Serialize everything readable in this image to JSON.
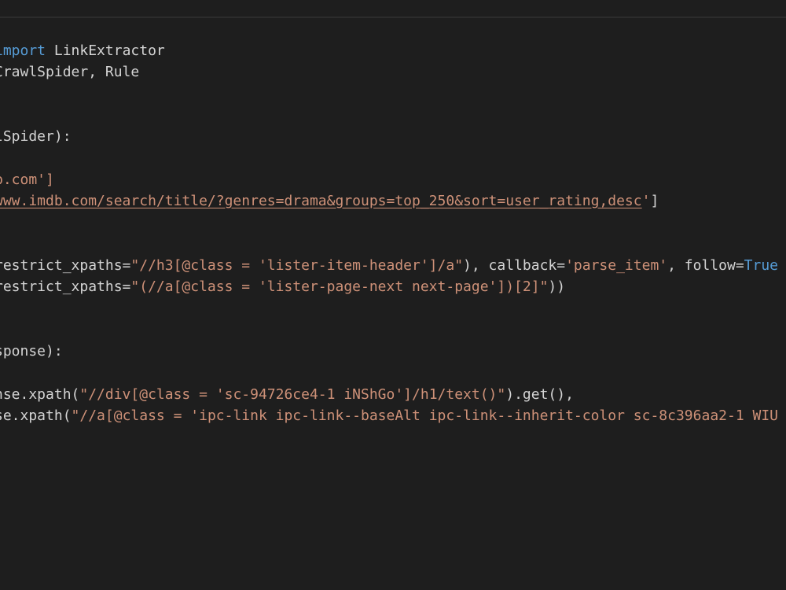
{
  "editor": {
    "lines": [
      [
        {
          "t": "kw",
          "v": "import"
        },
        {
          "t": "tok",
          "v": " LinkExtractor"
        }
      ],
      [
        {
          "t": "tok",
          "v": "CrawlSpider, Rule"
        }
      ],
      [],
      [],
      [
        {
          "t": "tok",
          "v": "lSpider):"
        }
      ],
      [],
      [
        {
          "t": "str",
          "v": "b.com']"
        }
      ],
      [
        {
          "t": "url",
          "v": "www.imdb.com/search/title/?genres=drama&groups=top_250&sort=user_rating,desc"
        },
        {
          "t": "str",
          "v": "'"
        },
        {
          "t": "tok",
          "v": "]"
        }
      ],
      [],
      [],
      [
        {
          "t": "tok",
          "v": "restrict_xpaths="
        },
        {
          "t": "str",
          "v": "\"//h3[@class = 'lister-item-header']/a\""
        },
        {
          "t": "tok",
          "v": "), callback="
        },
        {
          "t": "str",
          "v": "'parse_item'"
        },
        {
          "t": "tok",
          "v": ", follow="
        },
        {
          "t": "kw",
          "v": "True"
        }
      ],
      [
        {
          "t": "tok",
          "v": "restrict_xpaths="
        },
        {
          "t": "str",
          "v": "\"(//a[@class = 'lister-page-next next-page'])[2]\""
        },
        {
          "t": "tok",
          "v": "))"
        }
      ],
      [],
      [],
      [
        {
          "t": "tok",
          "v": "sponse):"
        }
      ],
      [],
      [
        {
          "t": "tok",
          "v": "nse.xpath("
        },
        {
          "t": "str",
          "v": "\"//div[@class = 'sc-94726ce4-1 iNShGo']/h1/text()\""
        },
        {
          "t": "tok",
          "v": ").get(),"
        }
      ],
      [
        {
          "t": "tok",
          "v": "se.xpath("
        },
        {
          "t": "str",
          "v": "\"//a[@class = 'ipc-link ipc-link--baseAlt ipc-link--inherit-color sc-8c396aa2-1 WIU"
        }
      ]
    ]
  },
  "colors": {
    "background": "#1e1e1e",
    "keyword": "#569cd6",
    "string": "#ce9178",
    "text": "#d4d4d4"
  }
}
